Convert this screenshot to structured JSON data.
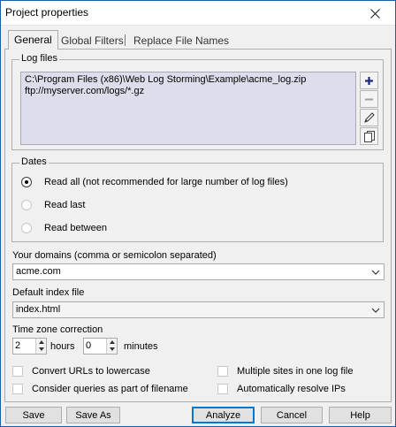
{
  "window": {
    "title": "Project properties"
  },
  "tabs": [
    {
      "label": "General",
      "active": true
    },
    {
      "label": "Global Filters",
      "active": false
    },
    {
      "label": "Replace File Names",
      "active": false
    }
  ],
  "log_files": {
    "group_label": "Log files",
    "items": [
      "C:\\Program Files (x86)\\Web Log Storming\\Example\\acme_log.zip",
      "ftp://myserver.com/logs/*.gz"
    ],
    "buttons": [
      "plus-icon",
      "minus-icon",
      "pencil-icon",
      "copy-icon"
    ]
  },
  "dates": {
    "group_label": "Dates",
    "options": [
      {
        "label": "Read all (not recommended for large number of log files)",
        "checked": true
      },
      {
        "label": "Read last",
        "checked": false
      },
      {
        "label": "Read between",
        "checked": false
      }
    ]
  },
  "domains": {
    "label": "Your domains (comma or semicolon separated)",
    "value": "acme.com"
  },
  "index_file": {
    "label": "Default index file",
    "value": "index.html"
  },
  "timezone": {
    "label": "Time zone correction",
    "hours_value": "2",
    "hours_label": "hours",
    "minutes_value": "0",
    "minutes_label": "minutes"
  },
  "checkboxes": [
    {
      "label": "Convert URLs to lowercase",
      "checked": false
    },
    {
      "label": "Consider queries as part of filename",
      "checked": false
    },
    {
      "label": "Multiple sites in one log file",
      "checked": false
    },
    {
      "label": "Automatically resolve IPs",
      "checked": false
    }
  ],
  "buttons": {
    "save": "Save",
    "save_as": "Save As",
    "analyze": "Analyze",
    "cancel": "Cancel",
    "help": "Help"
  }
}
